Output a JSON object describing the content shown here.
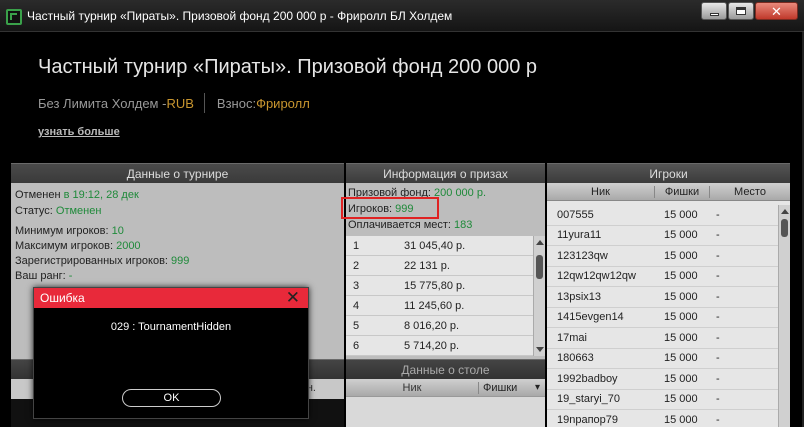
{
  "window": {
    "title": "Частный турнир «Пираты». Призовой фонд 200 000 р - Фриролл БЛ Холдем"
  },
  "header": {
    "title": "Частный турнир «Пираты». Призовой фонд 200 000 р",
    "game": "Без Лимита Холдем - ",
    "currency": "RUB",
    "buyin_label": "Взнос: ",
    "buyin_value": "Фриролл",
    "learn_more": "узнать больше"
  },
  "tournament": {
    "heading": "Данные о турнире",
    "cancelled_label": "Отменен",
    "cancelled_value": " в 19:12, 28 дек",
    "status_label": "Статус: ",
    "status_value": "Отменен",
    "min_players_label": "Минимум игроков: ",
    "min_players_value": "10",
    "max_players_label": "Максимум игроков: ",
    "max_players_value": "2000",
    "registered_label": "Зарегистрированных игроков: ",
    "registered_value": "999",
    "rank_label": "Ваш ранг: ",
    "rank_value": "-",
    "second_heading": "",
    "second_col": "н."
  },
  "prizes": {
    "heading": "Информация о призах",
    "pool_label": "Призовой фонд: ",
    "pool_value": "200 000 р.",
    "players_label": "Игроков: ",
    "players_value": "999",
    "paid_label": "Оплачивается мест: ",
    "paid_value": "183",
    "rows": [
      {
        "place": "1",
        "amount": "31 045,40 р."
      },
      {
        "place": "2",
        "amount": "22 131 р."
      },
      {
        "place": "3",
        "amount": "15 775,80 р."
      },
      {
        "place": "4",
        "amount": "11 245,60 р."
      },
      {
        "place": "5",
        "amount": "8 016,20 р."
      },
      {
        "place": "6",
        "amount": "5 714,20 р."
      }
    ],
    "scroll_fraction": 0.1
  },
  "table_info": {
    "heading": "Данные о столе",
    "col_nick": "Ник",
    "col_chips": "Фишки"
  },
  "players": {
    "heading": "Игроки",
    "col_nick": "Ник",
    "col_chips": "Фишки",
    "col_place": "Место",
    "rows": [
      {
        "nick": "007555",
        "chips": "15 000",
        "place": "-"
      },
      {
        "nick": "11yura11",
        "chips": "15 000",
        "place": "-"
      },
      {
        "nick": "123123qw",
        "chips": "15 000",
        "place": "-"
      },
      {
        "nick": "12qw12qw12qw",
        "chips": "15 000",
        "place": "-"
      },
      {
        "nick": "13psix13",
        "chips": "15 000",
        "place": "-"
      },
      {
        "nick": "1415evgen14",
        "chips": "15 000",
        "place": "-"
      },
      {
        "nick": "17mai",
        "chips": "15 000",
        "place": "-"
      },
      {
        "nick": "180663",
        "chips": "15 000",
        "place": "-"
      },
      {
        "nick": "1992badboy",
        "chips": "15 000",
        "place": "-"
      },
      {
        "nick": "19_staryi_70",
        "chips": "15 000",
        "place": "-"
      },
      {
        "nick": "19npапор79",
        "chips": "15 000",
        "place": "-"
      }
    ]
  },
  "dialog": {
    "title": "Ошибка",
    "message": "029 : TournamentHidden",
    "ok": "OK"
  },
  "colors": {
    "accent_green": "#1f8a3a",
    "gold": "#c9962f",
    "dialog_red": "#e8293a",
    "highlight_red": "#e02323"
  }
}
